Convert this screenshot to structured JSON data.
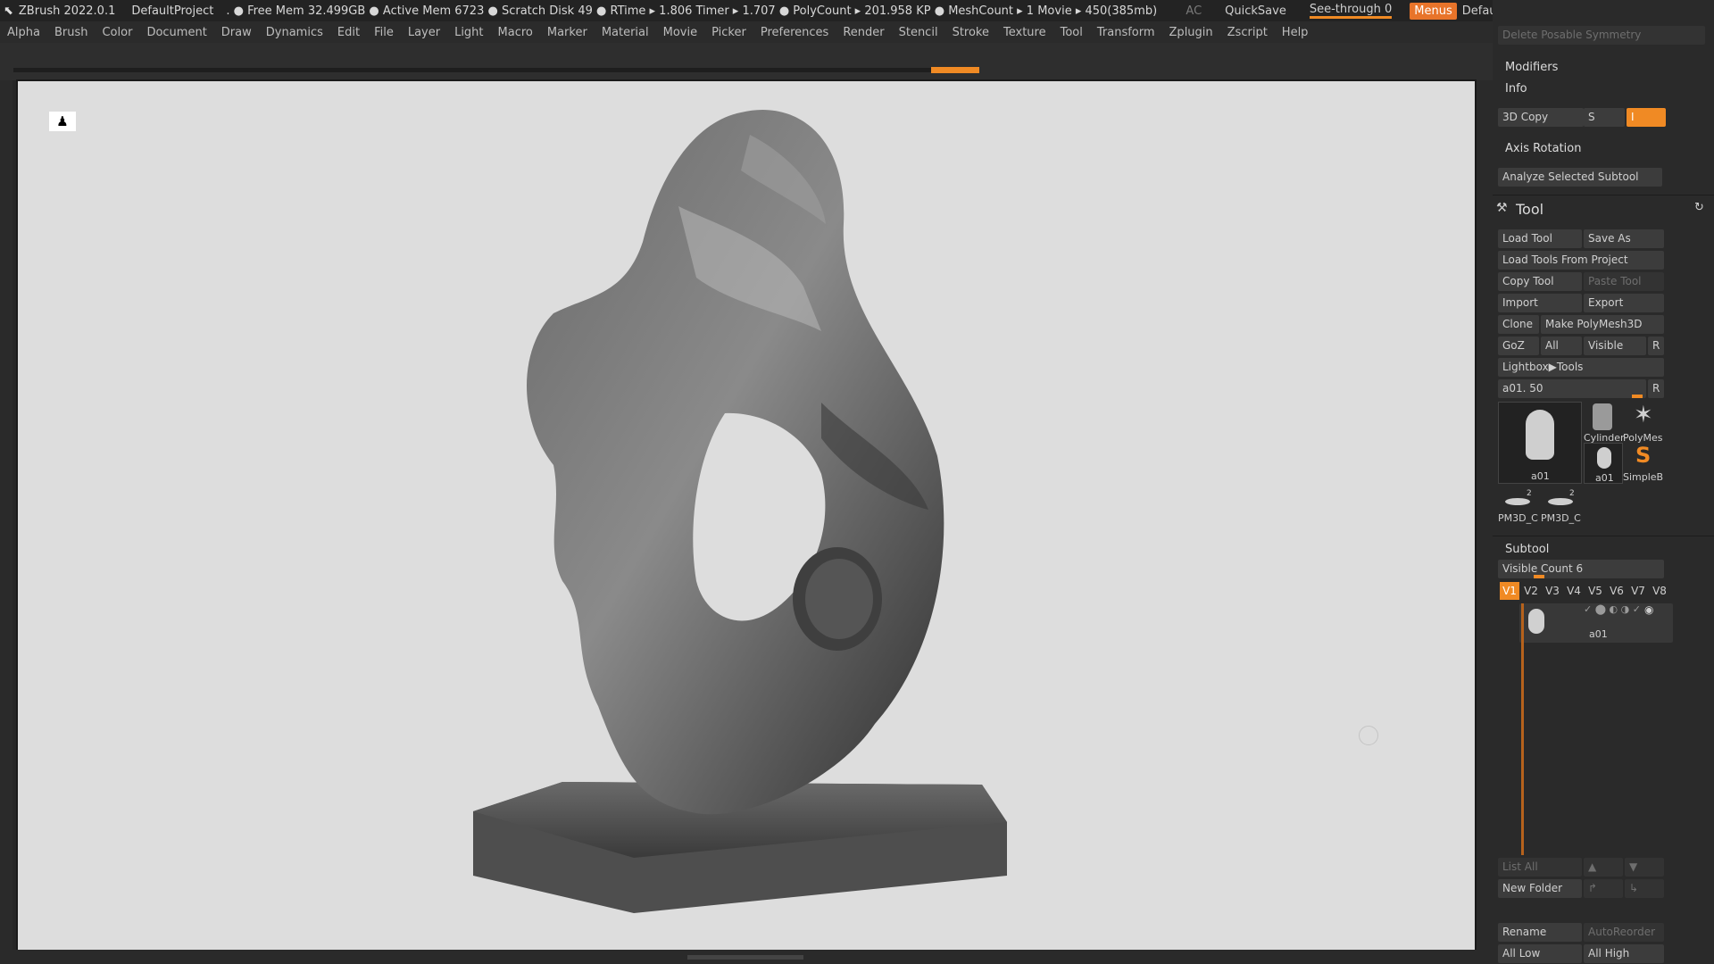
{
  "titlebar": {
    "app": "ZBrush 2022.0.1",
    "project": "DefaultProject",
    "stats": ". ● Free Mem 32.499GB ● Active Mem 6723 ● Scratch Disk 49 ●  RTime ▸ 1.806 Timer ▸ 1.707 ● PolyCount ▸ 201.958 KP  ● MeshCount ▸ 1  Movie ▸ 450(385mb)",
    "ac": "AC",
    "quicksave": "QuickSave",
    "seethrough": "See-through  0",
    "menus": "Menus",
    "script": "DefaultZScript"
  },
  "menubar": [
    "Alpha",
    "Brush",
    "Color",
    "Document",
    "Draw",
    "Dynamics",
    "Edit",
    "File",
    "Layer",
    "Light",
    "Macro",
    "Marker",
    "Material",
    "Movie",
    "Picker",
    "Preferences",
    "Render",
    "Stencil",
    "Stroke",
    "Texture",
    "Tool",
    "Transform",
    "Zplugin",
    "Zscript",
    "Help"
  ],
  "panel": {
    "delete_sym": "Delete Posable Symmetry",
    "modifiers": "Modifiers",
    "info": "Info",
    "copy3d": "3D Copy",
    "s": "S",
    "i": "I",
    "axis_rotation": "Axis Rotation",
    "analyze": "Analyze Selected Subtool",
    "tool_title": "Tool",
    "load_tool": "Load Tool",
    "save_as": "Save As",
    "load_from_project": "Load Tools From Project",
    "copy_tool": "Copy Tool",
    "paste_tool": "Paste Tool",
    "import": "Import",
    "export": "Export",
    "clone": "Clone",
    "make_polymesh": "Make PolyMesh3D",
    "goz": "GoZ",
    "all": "All",
    "visible": "Visible",
    "r": "R",
    "lightbox": "Lightbox▶Tools",
    "tool_slider": "a01. 50",
    "thumbs": [
      "a01",
      "Cylinder",
      "PolyMes",
      "a01",
      "SimpleB",
      "PM3D_C",
      "PM3D_C"
    ],
    "thumb_counts": [
      "2",
      "2"
    ],
    "subtool": "Subtool",
    "visible_count": "Visible Count 6",
    "v_buttons": [
      "V1",
      "V2",
      "V3",
      "V4",
      "V5",
      "V6",
      "V7",
      "V8"
    ],
    "subtool_item": "a01",
    "list_all": "List All",
    "new_folder": "New Folder",
    "rename": "Rename",
    "autoreorder": "AutoReorder",
    "all_low": "All Low",
    "all_high": "All High"
  }
}
